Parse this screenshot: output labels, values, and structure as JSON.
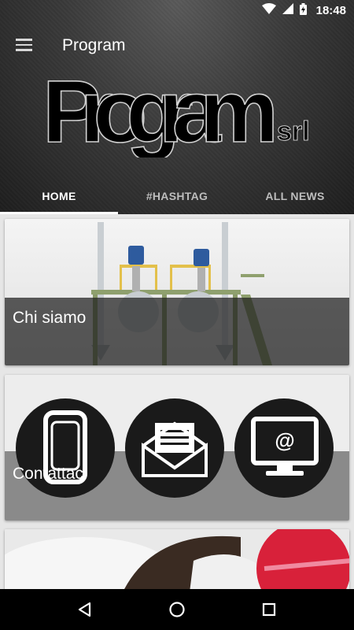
{
  "status_bar": {
    "time": "18:48",
    "icons": [
      "wifi-icon",
      "signal-icon",
      "battery-charging-icon"
    ]
  },
  "header": {
    "title": "Program",
    "logo_text_main": "Program",
    "logo_text_suffix": "srl",
    "menu_icon": "hamburger-menu-icon"
  },
  "tabs": [
    {
      "label": "HOME",
      "active": true
    },
    {
      "label": "#HASHTAG",
      "active": false
    },
    {
      "label": "ALL NEWS",
      "active": false
    }
  ],
  "cards": [
    {
      "title": "Chi siamo",
      "image": "industrial-mixing-plant"
    },
    {
      "title": "Contattaci",
      "icons": [
        "phone-icon",
        "envelope-icon",
        "computer-email-icon"
      ],
      "email_symbol": "@"
    },
    {
      "title": "",
      "image": "gloved-hand-tool"
    }
  ],
  "navigation": {
    "buttons": [
      "back-icon",
      "home-icon",
      "recents-icon"
    ]
  },
  "colors": {
    "header_dark": "#1e1e1e",
    "accent": "#ffffff",
    "card_band": "#1e1e1e"
  }
}
